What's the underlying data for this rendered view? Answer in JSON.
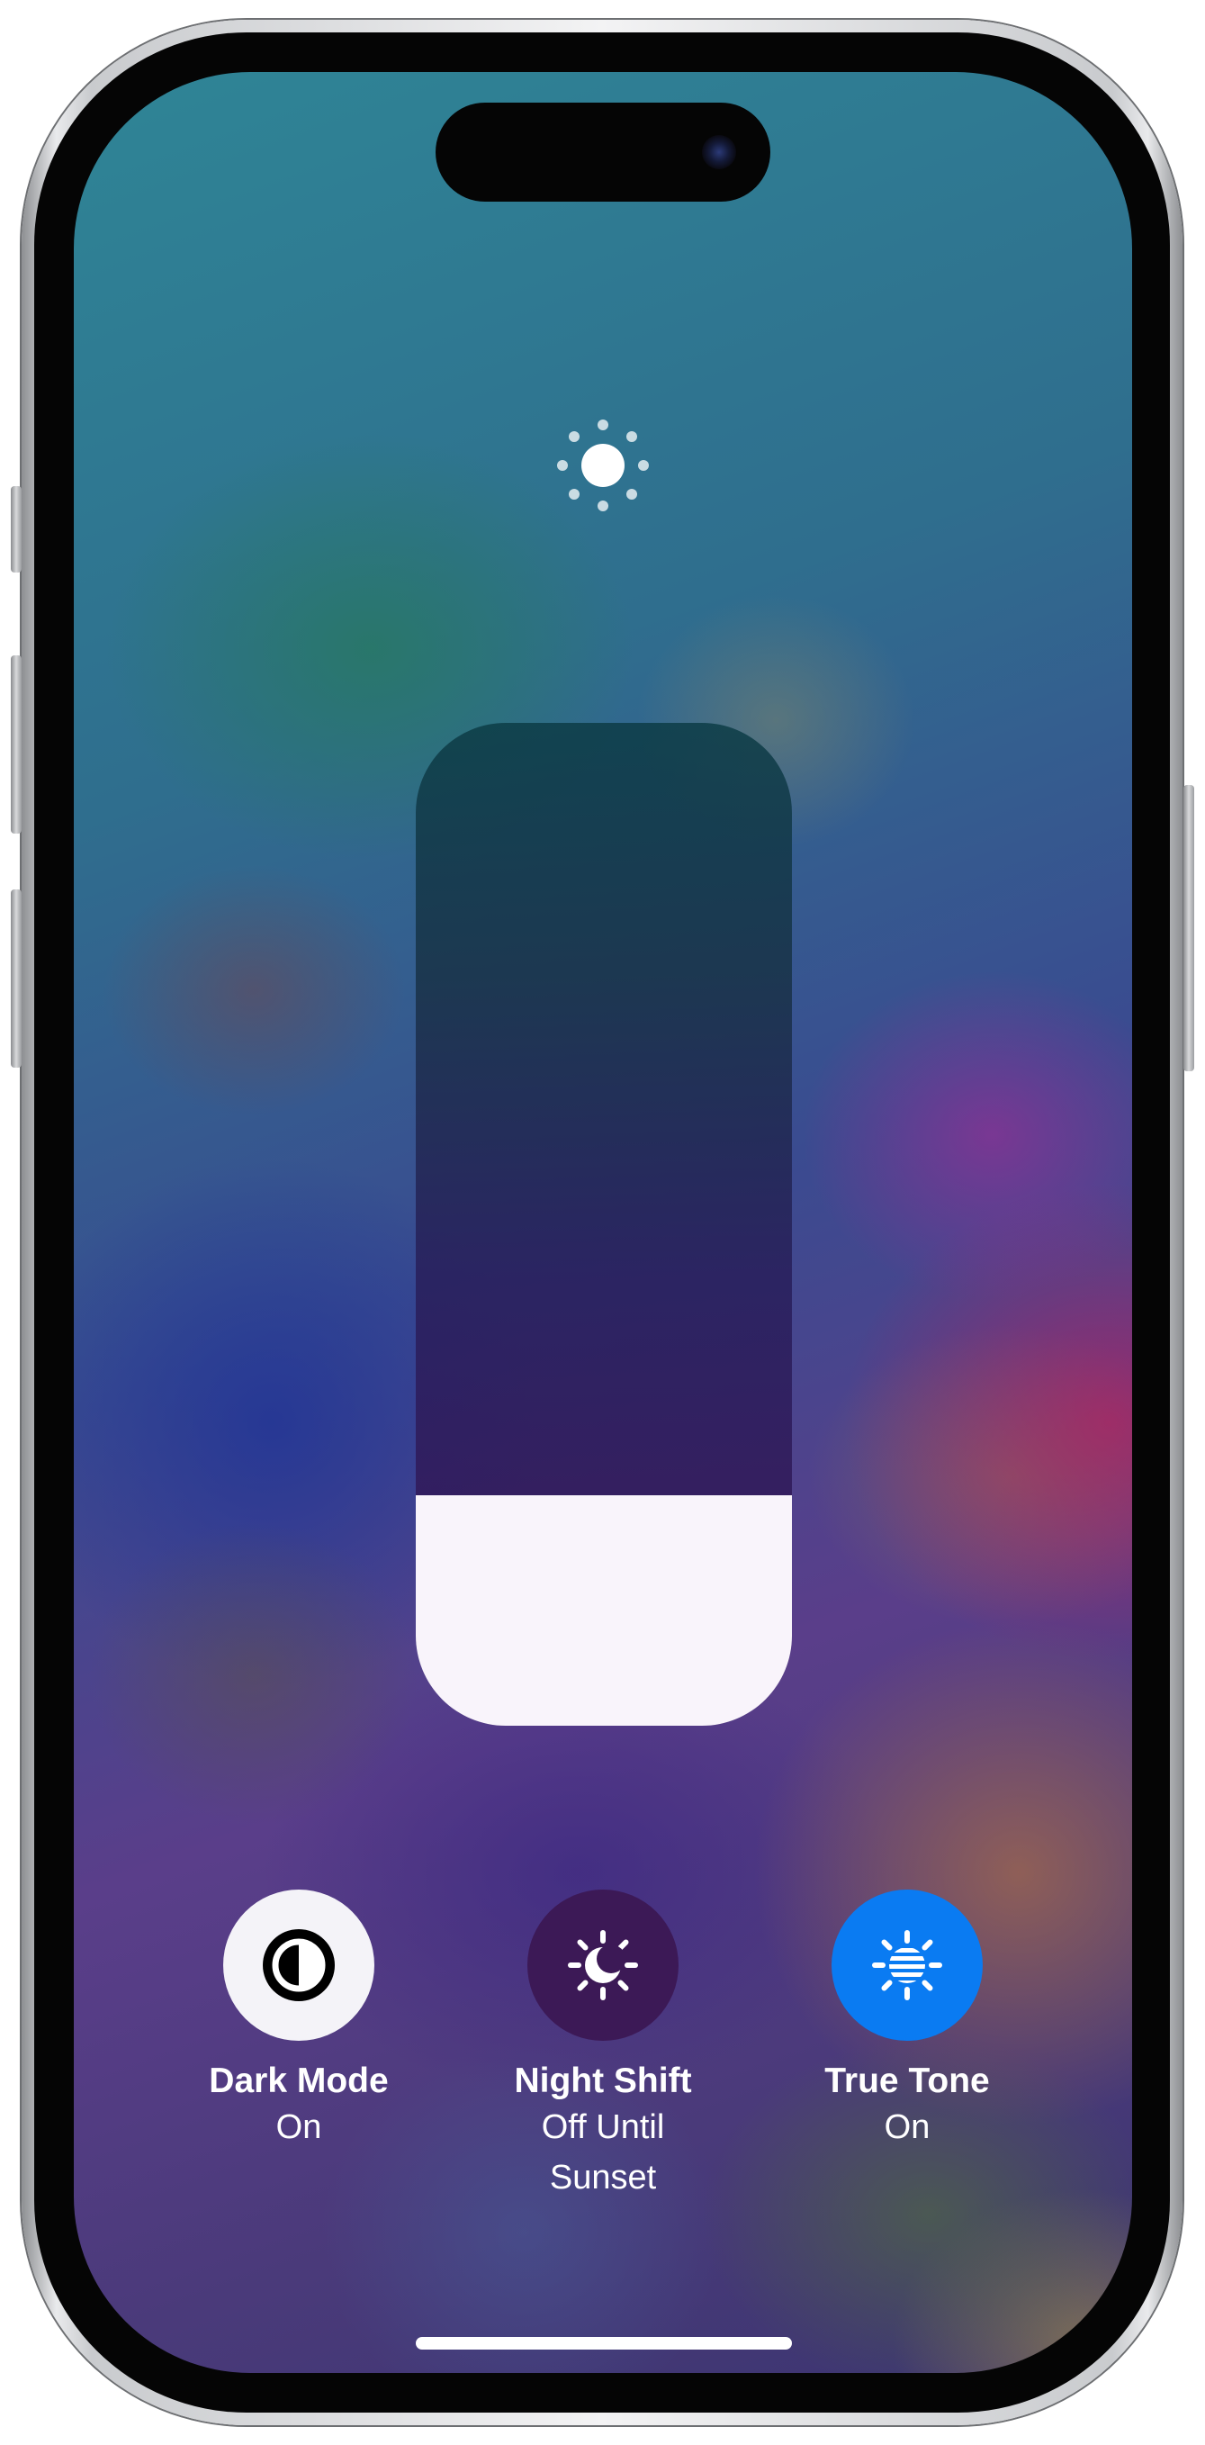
{
  "brightness": {
    "icon": "brightness-sun-icon",
    "level": 0.23
  },
  "toggles": [
    {
      "id": "dark-mode",
      "title": "Dark Mode",
      "status": "On",
      "icon": "dark-mode-icon",
      "active": true,
      "accent": "#f4f3f8"
    },
    {
      "id": "night-shift",
      "title": "Night Shift",
      "status": "Off Until Sunset",
      "icon": "night-shift-icon",
      "active": false,
      "accent": "#3c1956"
    },
    {
      "id": "true-tone",
      "title": "True Tone",
      "status": "On",
      "icon": "true-tone-icon",
      "active": true,
      "accent": "#0a7bf2"
    }
  ],
  "colors": {
    "slider_fill": "#f9f4fb",
    "label_text": "#ffffff"
  }
}
